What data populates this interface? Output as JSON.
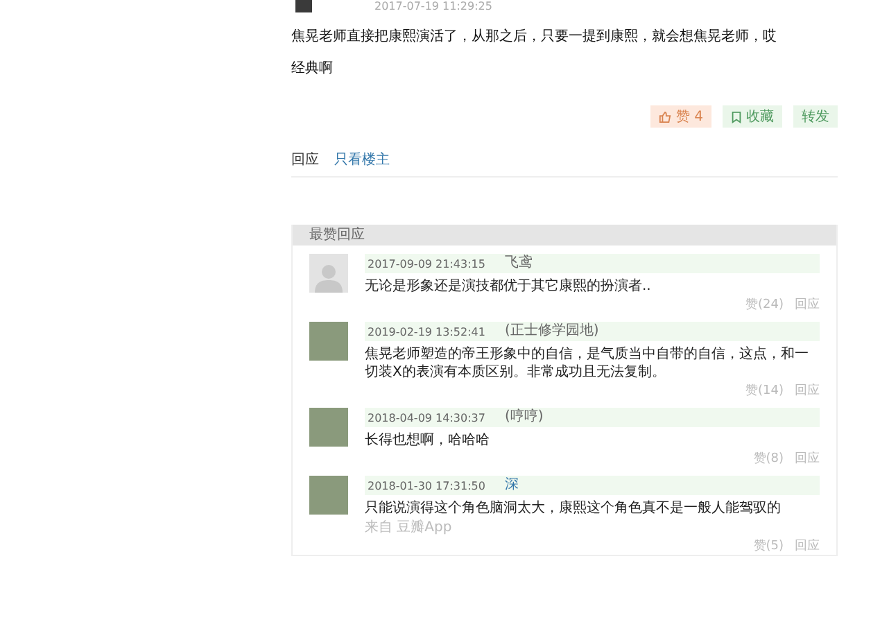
{
  "post": {
    "time": "2017-07-19 11:29:25",
    "paragraphs": [
      "焦晃老师直接把康熙演活了，从那之后，只要一提到康熙，就会想焦晃老师，哎",
      "经典啊"
    ]
  },
  "actions": [
    {
      "kind": "like",
      "label": "赞 4"
    },
    {
      "kind": "collect",
      "label": "收藏"
    },
    {
      "kind": "share",
      "label": "转发"
    }
  ],
  "tabs": [
    {
      "label": "回应",
      "selected": true
    },
    {
      "label": "只看楼主",
      "selected": false
    }
  ],
  "best_replies": {
    "title": "最赞回应",
    "comments": [
      {
        "kind": "default_avatar",
        "time": "2017-09-09 21:43:15",
        "author": "飞鸢",
        "text": "无论是形象还是演技都优于其它康熙的扮演者..",
        "like": "赞(24)",
        "reply": "回应"
      },
      {
        "kind": "photo_avatar",
        "time": "2019-02-19 13:52:41",
        "author": "(正士修学园地)",
        "text": "焦晃老师塑造的帝王形象中的自信，是气质当中自带的自信，这点，和一切装X的表演有本质区别。非常成功且无法复制。",
        "like": "赞(14)",
        "reply": "回应"
      },
      {
        "kind": "photo_avatar",
        "time": "2018-04-09 14:30:37",
        "author": "(哼哼)",
        "text": "长得也想啊，哈哈哈",
        "like": "赞(8)",
        "reply": "回应"
      },
      {
        "kind": "photo_avatar",
        "time": "2018-01-30 17:31:50",
        "author": "深",
        "author_link": true,
        "text": "只能说演得这个角色脑洞太大，康熙这个角色真不是一般人能驾驭的",
        "source": "来自 豆瓣App",
        "like": "赞(5)",
        "reply": "回应"
      }
    ]
  }
}
